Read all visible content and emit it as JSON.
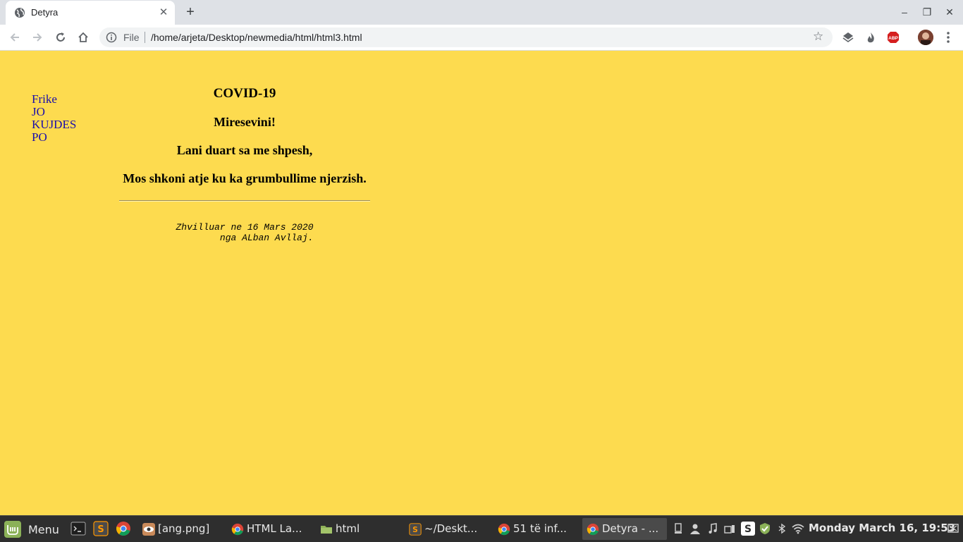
{
  "browser": {
    "tab": {
      "title": "Detyra",
      "close_glyph": "✕"
    },
    "new_tab_glyph": "+",
    "window_controls": {
      "minimize": "‒",
      "maximize": "❐",
      "close": "✕"
    },
    "address_bar": {
      "scheme_label": "File",
      "url": "/home/arjeta/Desktop/newmedia/html/html3.html"
    },
    "extensions": [
      {
        "icon": "layers-extension-icon"
      },
      {
        "icon": "flame-extension-icon"
      },
      {
        "icon": "adblock-plus-icon",
        "label": "ABP"
      }
    ],
    "colors": {
      "tabbar": "#dee1e6",
      "toolbar": "#ffffff",
      "omnibox": "#f1f3f4"
    }
  },
  "page": {
    "background": "#fddb4f",
    "nav_links": [
      "Frike",
      "JO",
      "KUJDES",
      "PO"
    ],
    "heading": "COVID-19",
    "subheadings": [
      "Miresevini!",
      "Lani duart sa me shpesh,",
      "Mos shkoni atje ku ka grumbullime njerzish."
    ],
    "footer_lines": [
      "Zhvilluar ne 16 Mars 2020",
      "nga ALban Avllaj."
    ]
  },
  "taskbar": {
    "menu_label": "Menu",
    "launchers": [
      "terminal-icon",
      "sublime-text-icon",
      "chrome-icon"
    ],
    "tasks": [
      {
        "label": "[ang.png]",
        "icon": "image-viewer-icon",
        "active": false
      },
      {
        "label": "HTML La...",
        "icon": "chrome-icon",
        "active": false
      },
      {
        "label": "html",
        "icon": "folder-icon",
        "active": false
      },
      {
        "label": "~/Deskt...",
        "icon": "sublime-text-icon",
        "active": false
      },
      {
        "label": "51 të inf...",
        "icon": "chrome-icon",
        "active": false
      },
      {
        "label": "Detyra - ...",
        "icon": "chrome-icon",
        "active": true
      }
    ],
    "clock": "Monday March 16, 19:53"
  }
}
